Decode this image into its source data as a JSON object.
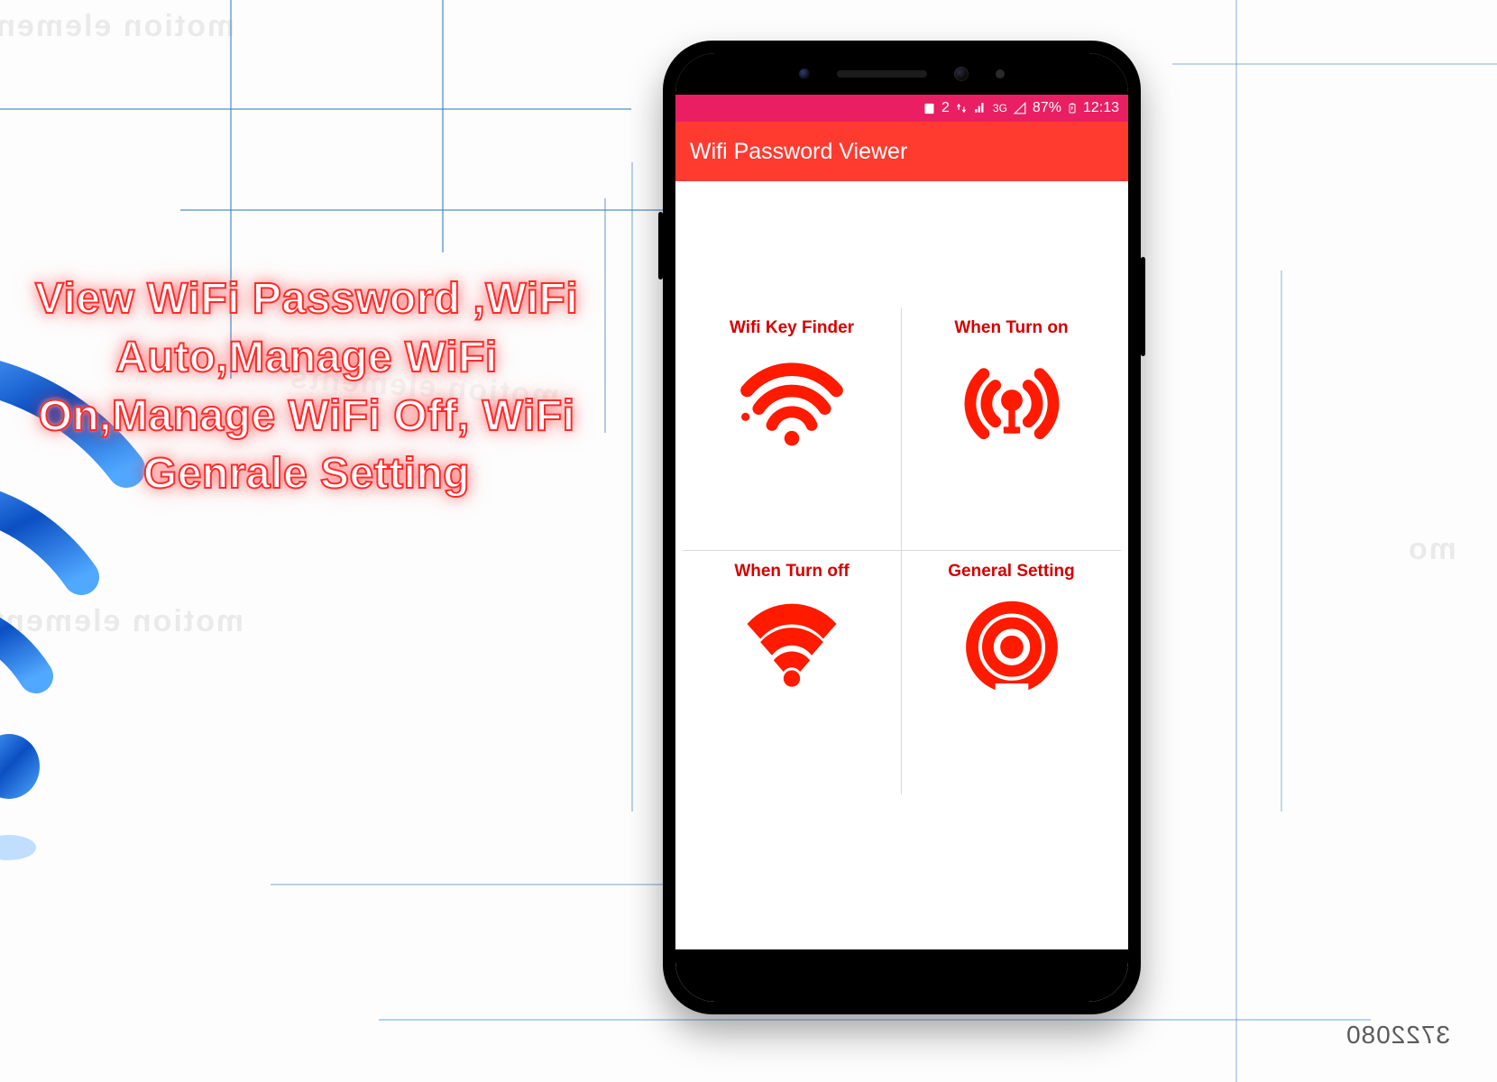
{
  "background": {
    "watermark_text": "motion elements",
    "corner_number": "3722080"
  },
  "promo": {
    "text": "View WiFi Password ,WiFi Auto,Manage WiFi On,Manage WiFi Off, WiFi Genrale Setting"
  },
  "phone": {
    "status_bar": {
      "indicator_2": "2",
      "network_label": "3G",
      "battery_percent": "87%",
      "time": "12:13"
    },
    "action_bar": {
      "title": "Wifi Password Viewer"
    },
    "tiles": [
      {
        "label": "Wifi Key Finder",
        "icon": "wifi-key-icon"
      },
      {
        "label": "When Turn on",
        "icon": "wifi-on-icon"
      },
      {
        "label": "When Turn off",
        "icon": "wifi-off-icon"
      },
      {
        "label": "General Setting",
        "icon": "wifi-target-icon"
      }
    ]
  }
}
